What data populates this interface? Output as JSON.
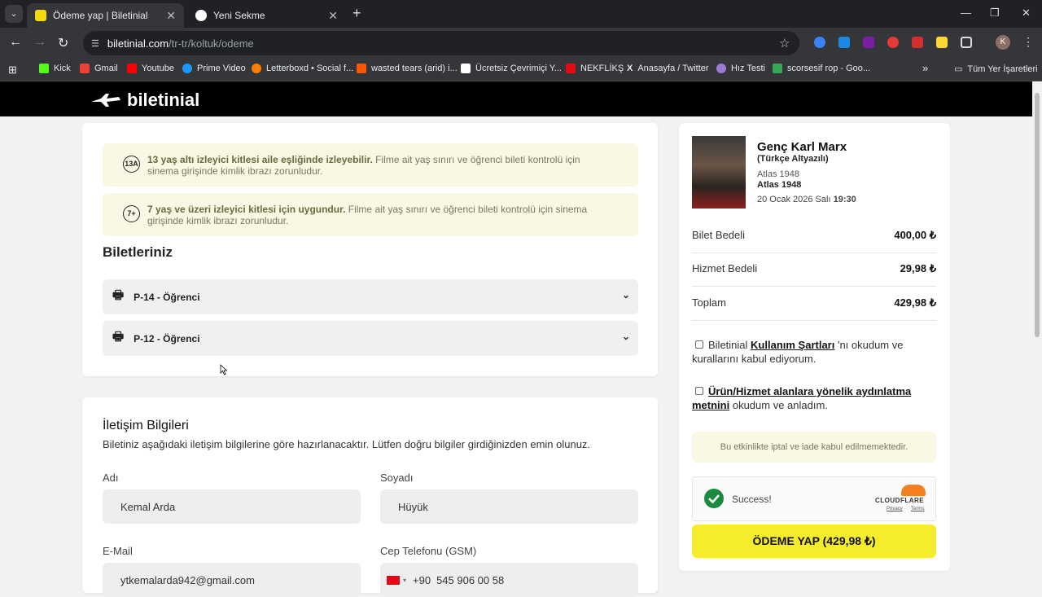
{
  "browser": {
    "tabs": [
      {
        "title": "Ödeme yap | Biletinial",
        "favicon_color": "#f5d90a"
      },
      {
        "title": "Yeni Sekme",
        "favicon_color": "#ffffff"
      }
    ],
    "url_host": "biletinial.com",
    "url_path": "/tr-tr/koltuk/odeme",
    "profile_initial": "K",
    "bookmarks": [
      {
        "label": "Kick",
        "color": "#53fc18"
      },
      {
        "label": "Gmail",
        "color": "#ea4335"
      },
      {
        "label": "Youtube",
        "color": "#ff0000"
      },
      {
        "label": "Prime Video",
        "color": "#1a98ff"
      },
      {
        "label": "Letterboxd • Social f...",
        "color": "#ff8000"
      },
      {
        "label": "wasted tears (arid) i...",
        "color": "#ff5500"
      },
      {
        "label": "Ücretsiz Çevrimiçi Y...",
        "color": "#ffffff"
      },
      {
        "label": "NEKFLİKŞ",
        "color": "#e50914"
      },
      {
        "label": "Anasayfa / Twitter",
        "color": "#000000"
      },
      {
        "label": "Hız Testi",
        "color": "#9c7ad6"
      },
      {
        "label": "scorsesif rop - Goo...",
        "color": "#34a853"
      }
    ],
    "all_bookmarks": "Tüm Yer İşaretleri"
  },
  "site": {
    "logo_text": "biletinial"
  },
  "notices": [
    {
      "badge": "13A",
      "bold": "13 yaş altı izleyici kitlesi aile eşliğinde izleyebilir.",
      "text": " Filme ait yaş sınırı ve öğrenci bileti kontrolü için sinema girişinde kimlik ibrazı zorunludur."
    },
    {
      "badge": "7+",
      "bold": "7 yaş ve üzeri izleyici kitlesi için uygundur.",
      "text": " Filme ait yaş sınırı ve öğrenci bileti kontrolü için sinema girişinde kimlik ibrazı zorunludur."
    }
  ],
  "tickets_title": "Biletleriniz",
  "tickets": [
    "P-14 - Öğrenci",
    "P-12 - Öğrenci"
  ],
  "contact": {
    "title": "İletişim Bilgileri",
    "subtitle": "Biletiniz aşağıdaki iletişim bilgilerine göre hazırlanacaktır. Lütfen doğru bilgiler girdiğinizden emin olunuz.",
    "first_name_label": "Adı",
    "first_name": "Kemal Arda",
    "last_name_label": "Soyadı",
    "last_name": "Hüyük",
    "email_label": "E-Mail",
    "email": "ytkemalarda942@gmail.com",
    "phone_label": "Cep Telefonu (GSM)",
    "phone_code": "+90",
    "phone": "545 906 00 58"
  },
  "summary": {
    "movie_title": "Genç Karl Marx",
    "movie_subtitle": "(Türkçe Altyazılı)",
    "venue": "Atlas 1948",
    "hall": "Atlas 1948",
    "date": "20 Ocak 2026 Salı",
    "time": "19:30",
    "ticket_label": "Bilet Bedeli",
    "ticket_value": "400,00 ₺",
    "service_label": "Hizmet Bedeli",
    "service_value": "29,98 ₺",
    "total_label": "Toplam",
    "total_value": "429,98 ₺",
    "terms1_pre": "Biletinial ",
    "terms1_link": "Kullanım Şartları",
    "terms1_post": " 'nı okudum ve kurallarını kabul ediyorum.",
    "terms2_link": "Ürün/Hizmet alanlara yönelik aydınlatma metnini",
    "terms2_post": " okudum ve anladım.",
    "refund_note": "Bu etkinlikte iptal ve iade kabul edilmemektedir.",
    "captcha_status": "Success!",
    "captcha_brand": "CLOUDFLARE",
    "captcha_privacy": "Privacy",
    "captcha_terms": "Terms",
    "pay_button": "ÖDEME YAP (429,98 ₺)"
  }
}
